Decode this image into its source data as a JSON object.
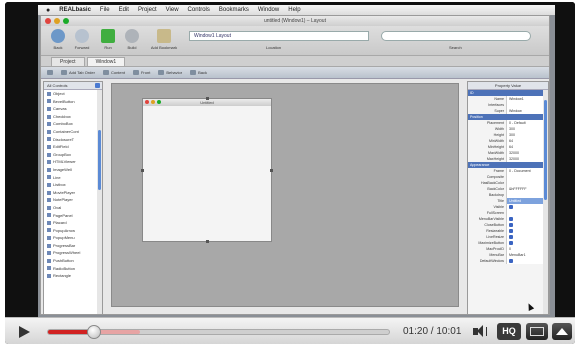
{
  "menubar": {
    "app_name": "REALbasic",
    "items": [
      "File",
      "Edit",
      "Project",
      "View",
      "Controls",
      "Bookmarks",
      "Window",
      "Help"
    ]
  },
  "ide_window": {
    "title": "untitled (Window1) – Layout",
    "toolbar": {
      "buttons": [
        "Back",
        "Forward",
        "Run",
        "Build",
        "Add Bookmark"
      ],
      "location_value": "Window1 Layout",
      "location_label": "Location",
      "search_label": "Search"
    },
    "tabs": [
      "Project",
      "Window1"
    ],
    "subbar_items": [
      "Add Tab Order",
      "Content",
      "Front",
      "Behavior",
      "Back"
    ],
    "library": {
      "header": "All Controls",
      "items": [
        "Object",
        "BevelButton",
        "Canvas",
        "Checkbox",
        "ComboBox",
        "ContainerCont",
        "DisclosureT",
        "EditField",
        "GroupBox",
        "HTMLViewer",
        "ImageWell",
        "Line",
        "Listbox",
        "MoviePlayer",
        "NotePlayer",
        "Oval",
        "PagePanel",
        "Placard",
        "PopupArrow",
        "PopupMenu",
        "ProgressBar",
        "ProgressWheel",
        "PushButton",
        "RadioButton",
        "Rectangle"
      ]
    },
    "design_window": {
      "title": "Untitled"
    },
    "properties": {
      "header": "Property Value",
      "rows": [
        {
          "k": "ID",
          "v": "",
          "group": true
        },
        {
          "k": "Name",
          "v": "Window1"
        },
        {
          "k": "Interfaces",
          "v": ""
        },
        {
          "k": "Super",
          "v": "Window"
        },
        {
          "k": "Position",
          "v": "",
          "group": true
        },
        {
          "k": "Placement",
          "v": "0 - Default"
        },
        {
          "k": "Width",
          "v": "300"
        },
        {
          "k": "Height",
          "v": "300"
        },
        {
          "k": "MinWidth",
          "v": "64"
        },
        {
          "k": "MinHeight",
          "v": "64"
        },
        {
          "k": "MaxWidth",
          "v": "32000"
        },
        {
          "k": "MaxHeight",
          "v": "32000"
        },
        {
          "k": "Appearance",
          "v": "",
          "group": true
        },
        {
          "k": "Frame",
          "v": "0 - Document"
        },
        {
          "k": "Composite",
          "v": ""
        },
        {
          "k": "HasBackColor",
          "v": ""
        },
        {
          "k": "BackColor",
          "v": "&hFFFFFF"
        },
        {
          "k": "Backdrop",
          "v": ""
        },
        {
          "k": "Title",
          "v": "Untitled",
          "sel": true
        },
        {
          "k": "Visible",
          "v": "",
          "chk": true
        },
        {
          "k": "FullScreen",
          "v": ""
        },
        {
          "k": "MenuBarVisible",
          "v": "",
          "chk": true
        },
        {
          "k": "CloseButton",
          "v": "",
          "chk": true
        },
        {
          "k": "Resizeable",
          "v": "",
          "chk": true
        },
        {
          "k": "LiveResize",
          "v": "",
          "chk": true
        },
        {
          "k": "MaximizeButton",
          "v": "",
          "chk": true
        },
        {
          "k": "MacProcID",
          "v": "0"
        },
        {
          "k": "MenuBar",
          "v": "MenuBar1"
        },
        {
          "k": "DefaultWindow",
          "v": "",
          "chk": true
        }
      ]
    }
  },
  "player": {
    "time": "01:20 / 10:01",
    "progress": 0.135,
    "loaded": 0.27,
    "hq_label": "HQ",
    "accent": "#d12222"
  }
}
